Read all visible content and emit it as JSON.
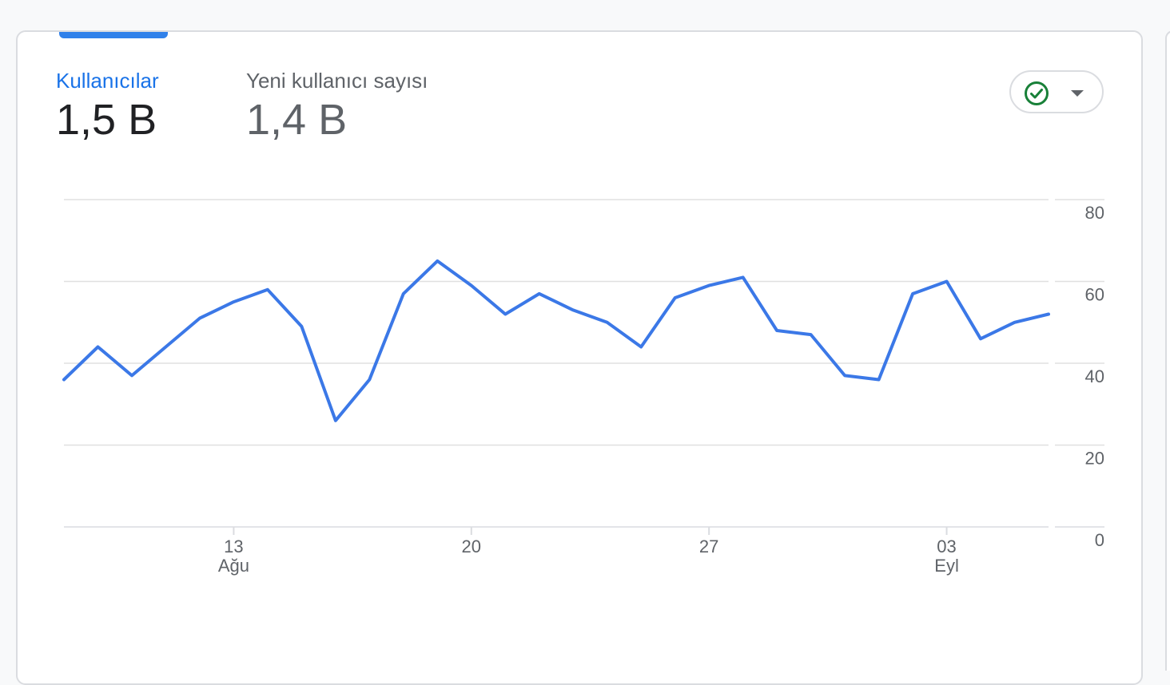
{
  "metrics": [
    {
      "label": "Kullanıcılar",
      "value": "1,5 B",
      "active": true
    },
    {
      "label": "Yeni kullanıcı sayısı",
      "value": "1,4 B",
      "active": false
    }
  ],
  "status_chip": {
    "icon": "check-circle-icon",
    "state_color": "#188038"
  },
  "colors": {
    "accent": "#1a73e8",
    "line": "#3b78e7",
    "grid": "#e0e0e0"
  },
  "chart_data": {
    "type": "line",
    "x": [
      "08 Ağu",
      "09 Ağu",
      "10 Ağu",
      "11 Ağu",
      "12 Ağu",
      "13 Ağu",
      "14 Ağu",
      "15 Ağu",
      "16 Ağu",
      "17 Ağu",
      "18 Ağu",
      "19 Ağu",
      "20 Ağu",
      "21 Ağu",
      "22 Ağu",
      "23 Ağu",
      "24 Ağu",
      "25 Ağu",
      "26 Ağu",
      "27 Ağu",
      "28 Ağu",
      "29 Ağu",
      "30 Ağu",
      "31 Ağu",
      "01 Eyl",
      "02 Eyl",
      "03 Eyl",
      "04 Eyl",
      "05 Eyl",
      "06 Eyl"
    ],
    "series": [
      {
        "values": [
          36,
          44,
          37,
          44,
          51,
          55,
          58,
          49,
          26,
          36,
          57,
          65,
          59,
          52,
          57,
          53,
          50,
          44,
          56,
          59,
          61,
          48,
          47,
          37,
          36,
          57,
          60,
          46,
          50,
          52
        ]
      }
    ],
    "y_ticks": [
      "0",
      "20",
      "40",
      "60",
      "80"
    ],
    "ylim": [
      0,
      80
    ],
    "x_ticks": [
      {
        "index": 5,
        "day": "13",
        "month": "Ağu"
      },
      {
        "index": 12,
        "day": "20",
        "month": ""
      },
      {
        "index": 19,
        "day": "27",
        "month": ""
      },
      {
        "index": 26,
        "day": "03",
        "month": "Eyl"
      }
    ],
    "y_axis_position": "right",
    "grid": true,
    "title": "",
    "xlabel": "",
    "ylabel": ""
  }
}
